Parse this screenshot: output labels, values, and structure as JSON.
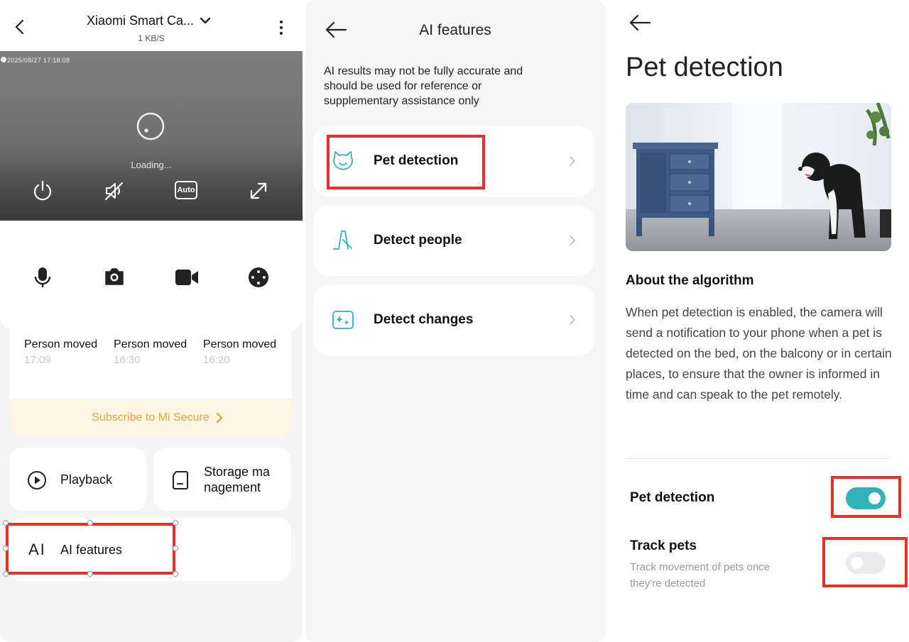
{
  "camera": {
    "title": "Xiaomi Smart Ca...",
    "speed": "1 KB/S",
    "timestamp": "2025/08/27 17:18:08",
    "loading": "Loading...",
    "auto_badge": "Auto",
    "events": [
      {
        "title": "Person moved",
        "time": "17:09"
      },
      {
        "title": "Person moved",
        "time": "16:30"
      },
      {
        "title": "Person moved",
        "time": "16:20"
      }
    ],
    "subscribe": "Subscribe to Mi Secure",
    "tiles": {
      "playback": "Playback",
      "storage_line1": "Storage ma",
      "storage_line2": "nagement",
      "ai_icon": "AI",
      "ai": "AI features"
    }
  },
  "ai_features": {
    "title": "AI features",
    "disclaimer": "AI results may not be fully accurate and should be used for reference or supplementary assistance only",
    "items": [
      {
        "label": "Pet detection",
        "icon": "cat-face-icon"
      },
      {
        "label": "Detect people",
        "icon": "person-walking-icon"
      },
      {
        "label": "Detect changes",
        "icon": "sparkle-frame-icon"
      }
    ]
  },
  "pet_detection": {
    "title": "Pet detection",
    "about_heading": "About the algorithm",
    "about_text": "When pet detection is enabled, the camera will send a notification to your phone when a pet is detected on the bed, on the balcony or in certain places, to ensure that the owner is informed in time and can speak to the pet remotely.",
    "settings": [
      {
        "label": "Pet detection",
        "enabled": true
      },
      {
        "label": "Track pets",
        "description": "Track movement of pets once they're detected",
        "enabled": false
      }
    ]
  },
  "colors": {
    "accent_teal": "#2fb4b8",
    "highlight_red": "#e8302a",
    "subscribe_orange": "#e5a534"
  }
}
